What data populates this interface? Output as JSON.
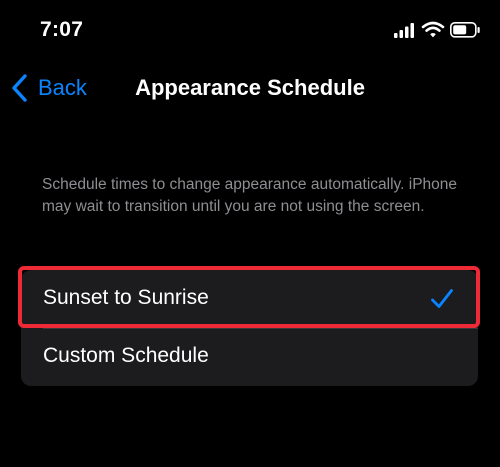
{
  "status_bar": {
    "time": "7:07",
    "icons": [
      "cellular-signal-icon",
      "wifi-icon",
      "battery-icon"
    ]
  },
  "nav": {
    "back_label": "Back",
    "title": "Appearance Schedule"
  },
  "description": "Schedule times to change appearance automatically. iPhone may wait to transition until you are not using the screen.",
  "options": [
    {
      "label": "Sunset to Sunrise",
      "selected": true
    },
    {
      "label": "Custom Schedule",
      "selected": false
    }
  ],
  "colors": {
    "accent": "#0a84ff",
    "highlight": "#ee2a36",
    "group_background": "#1c1c1e",
    "secondary_text": "#8e8e93"
  }
}
